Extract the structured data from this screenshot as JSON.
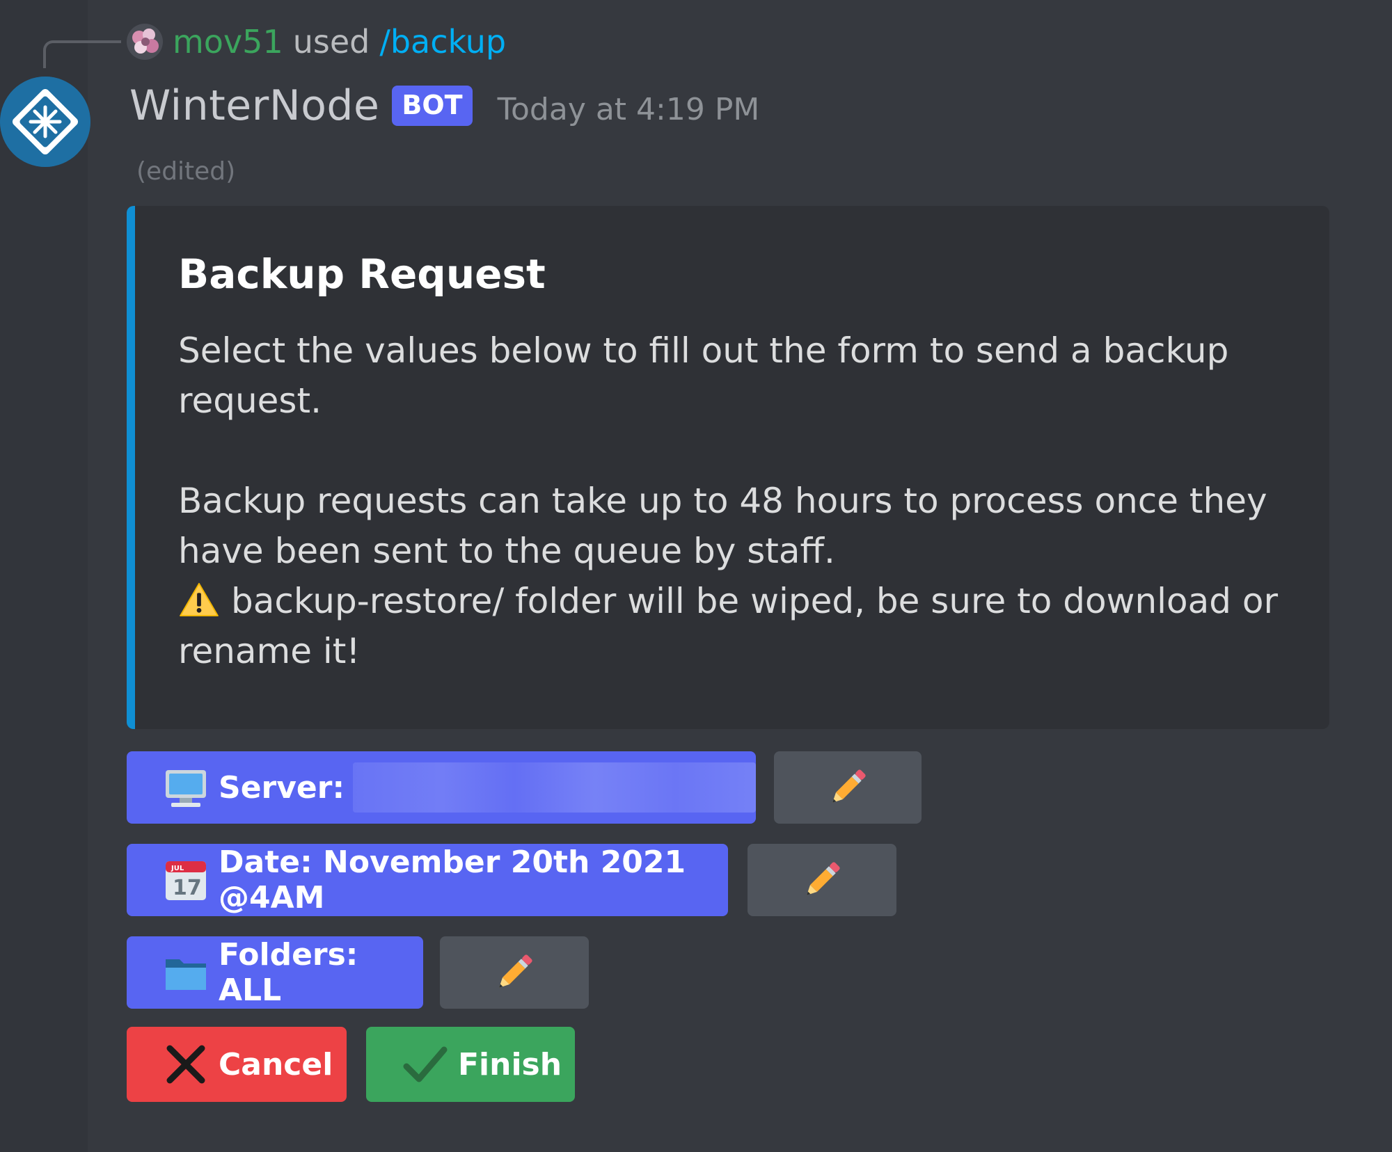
{
  "command": {
    "user": "mov51",
    "used_text": "used",
    "command_name": "/backup"
  },
  "message": {
    "author": "WinterNode",
    "bot_tag": "BOT",
    "timestamp": "Today at 4:19 PM",
    "edited": "(edited)"
  },
  "embed": {
    "accent_color": "#0f8fd4",
    "title": "Backup Request",
    "paragraph1": "Select the values below to fill out the form to send a backup request.",
    "paragraph2": "Backup requests can take up to 48 hours to process once they have been sent to the queue by staff.",
    "warning_text": "backup-restore/ folder will be wiped, be sure to download or rename it!",
    "warning_icon": "warning-icon"
  },
  "buttons": {
    "server": {
      "label": "Server:",
      "icon": "computer-icon",
      "value_redacted": true
    },
    "date": {
      "label": "Date: November 20th 2021 @4AM",
      "icon": "calendar-icon"
    },
    "folders": {
      "label": "Folders: ALL",
      "icon": "folder-icon"
    },
    "edit_icon": "pencil-icon",
    "cancel": {
      "label": "Cancel",
      "icon": "x-icon",
      "color": "#ed4245"
    },
    "finish": {
      "label": "Finish",
      "icon": "check-icon",
      "color": "#3ba55d"
    }
  },
  "colors": {
    "background": "#36393f",
    "blurple": "#5865f2",
    "secondary": "#4f545c",
    "command_user": "#3ba55d",
    "command_link": "#00aff4"
  }
}
